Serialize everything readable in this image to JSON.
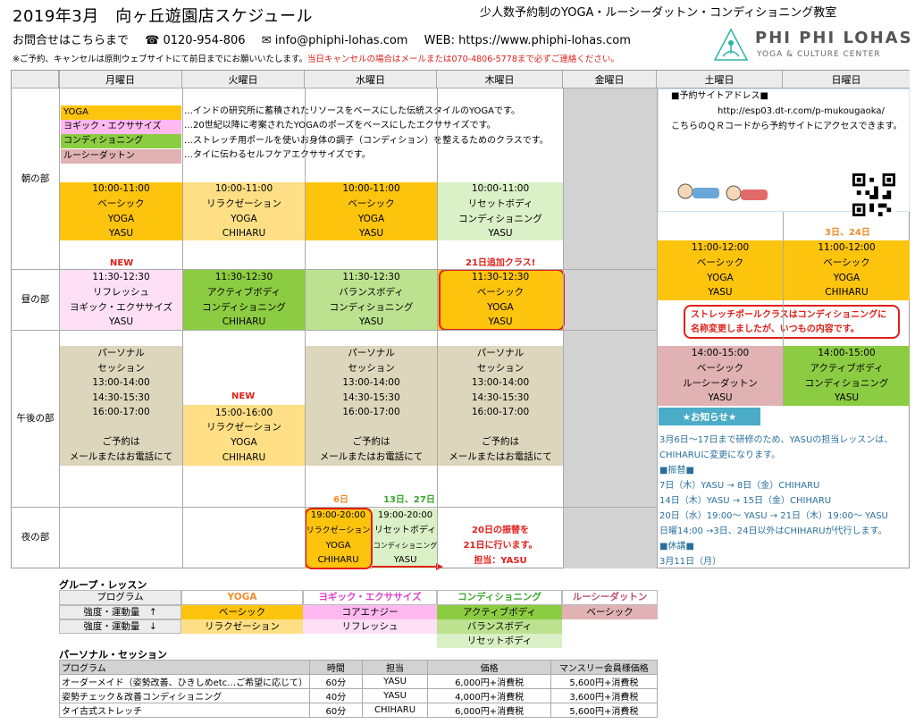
{
  "header": {
    "title": "2019年3月　向ヶ丘遊園店スケジュール",
    "subtitle": "少人数予約制のYOGA・ルーシーダットン・コンディショニング教室",
    "contact_label": "お問合せはこちらまで",
    "phone": "☎ 0120-954-806",
    "email": "✉ info@phiphi-lohas.com",
    "web": "WEB: https://www.phiphi-lohas.com",
    "note": "※ご予約、キャンセルは原則ウェブサイトにて前日までにお願いいたします。",
    "note_red": "当日キャンセルの場合はメールまたは070-4806-5778まで必ずご連絡ください。"
  },
  "logo": {
    "name": "PHI PHI LOHAS",
    "tagline": "YOGA & CULTURE CENTER"
  },
  "days": [
    "月曜日",
    "火曜日",
    "水曜日",
    "木曜日",
    "金曜日",
    "土曜日",
    "日曜日"
  ],
  "periods": [
    "朝の部",
    "昼の部",
    "午後の部",
    "夜の部"
  ],
  "legend": [
    {
      "tag": "YOGA",
      "desc": "…インドの研究所に蓄積されたリソースをベースにした伝統スタイルのYOGAです。",
      "color": "#fdc40e"
    },
    {
      "tag": "ヨギック・エクササイズ",
      "desc": "…20世紀以降に考案されたYOGAのポーズをベースにしたエクササイズです。",
      "color": "#ffb9f0"
    },
    {
      "tag": "コンディショニング",
      "desc": "…ストレッチ用ポールを使いお身体の調子（コンディション）を整えるためのクラスです。",
      "color": "#8ccc43"
    },
    {
      "tag": "ルーシーダットン",
      "desc": "…タイに伝わるセルフケアエクササイズです。",
      "color": "#e0b2b3"
    }
  ],
  "site": {
    "title": "■予約サイトアドレス■",
    "url": "http://esp03.dt-r.com/p-mukougaoka/",
    "desc": "こちらのＱＲコードから予約サイトにアクセスできます。"
  },
  "morning": {
    "mon": [
      "10:00-11:00",
      "ベーシック",
      "YOGA",
      "YASU"
    ],
    "tue": [
      "10:00-11:00",
      "リラクゼーション",
      "YOGA",
      "CHIHARU"
    ],
    "wed": [
      "10:00-11:00",
      "ベーシック",
      "YOGA",
      "YASU"
    ],
    "thu": [
      "10:00-11:00",
      "リセットボディ",
      "コンディショニング",
      "YASU"
    ]
  },
  "weekend_note": "3日、24日",
  "sat_late": [
    "11:00-12:00",
    "ベーシック",
    "YOGA",
    "YASU"
  ],
  "sun_late": [
    "11:00-12:00",
    "ベーシック",
    "YOGA",
    "CHIHARU"
  ],
  "noon": {
    "new_label": "NEW",
    "thu_note": "21日追加クラス!",
    "mon": [
      "11:30-12:30",
      "リフレッシュ",
      "ヨギック・エクササイズ",
      "YASU"
    ],
    "tue": [
      "11:30-12:30",
      "アクティブボディ",
      "コンディショニング",
      "CHIHARU"
    ],
    "wed": [
      "11:30-12:30",
      "バランスボディ",
      "コンディショニング",
      "YASU"
    ],
    "thu": [
      "11:30-12:30",
      "ベーシック",
      "YOGA",
      "YASU"
    ]
  },
  "callout": "ストレッチポールクラスはコンディショニングに\n名称変更しましたが、いつもの内容です。",
  "afternoon": {
    "personal": [
      "パーソナル",
      "セッション",
      "13:00-14:00",
      "14:30-15:30",
      "16:00-17:00",
      "",
      "ご予約は",
      "メールまたはお電話にて"
    ],
    "tue_new": "NEW",
    "tue": [
      "15:00-16:00",
      "リラクゼーション",
      "YOGA",
      "CHIHARU"
    ],
    "sat": [
      "14:00-15:00",
      "ベーシック",
      "ルーシーダットン",
      "YASU"
    ],
    "sun": [
      "14:00-15:00",
      "アクティブボディ",
      "コンディショニング",
      "YASU"
    ]
  },
  "notice": {
    "title": "★お知らせ★",
    "lines": [
      "3月6日～17日まで研修のため、YASUの担当レッスンは、",
      "CHIHARUに変更になります。",
      "■振替■",
      "7日（木）YASU → 8日（金）CHIHARU",
      "14日（木）YASU → 15日（金）CHIHARU",
      "20日（水）19:00～ YASU → 21日（木）19:00～ YASU",
      "日曜14:00 →3日、24日以外はCHIHARUが代行します。",
      "■休講■",
      "3月11日（月）"
    ]
  },
  "evening": {
    "wed_note": "6日",
    "thu_note": "13日、27日",
    "wed": [
      "19:00-20:00",
      "リラクゼーション",
      "YOGA",
      "CHIHARU"
    ],
    "thu": [
      "19:00-20:00",
      "リセットボディ",
      "コンディショニング",
      "YASU"
    ],
    "transfer": [
      "20日の振替を",
      "21日に行います。",
      "担当：YASU"
    ]
  },
  "group": {
    "title": "グループ・レッスン",
    "program": "プログラム",
    "cols": [
      "YOGA",
      "ヨギック・エクササイズ",
      "コンディショニング",
      "ルーシーダットン"
    ],
    "up": "強度・運動量　↑",
    "down": "強度・運動量　↓",
    "yoga": [
      "ベーシック",
      "リラクゼーション"
    ],
    "yogic": [
      "コアエナジー",
      "リフレッシュ"
    ],
    "cond": [
      "アクティブボディ",
      "バランスボディ",
      "リセットボディ"
    ],
    "rusi": [
      "ベーシック"
    ]
  },
  "personal": {
    "title": "パーソナル・セッション",
    "headers": [
      "プログラム",
      "時間",
      "担当",
      "価格",
      "マンスリー会員様価格"
    ],
    "rows": [
      [
        "オーダーメイド（姿勢改善、ひきしめetc…ご希望に応じて）",
        "60分",
        "YASU",
        "6,000円+消費税",
        "5,600円+消費税"
      ],
      [
        "姿勢チェック＆改善コンディショニング",
        "40分",
        "YASU",
        "4,000円+消費税",
        "3,600円+消費税"
      ],
      [
        "タイ古式ストレッチ",
        "60分",
        "CHIHARU",
        "6,000円+消費税",
        "5,600円+消費税"
      ]
    ]
  }
}
